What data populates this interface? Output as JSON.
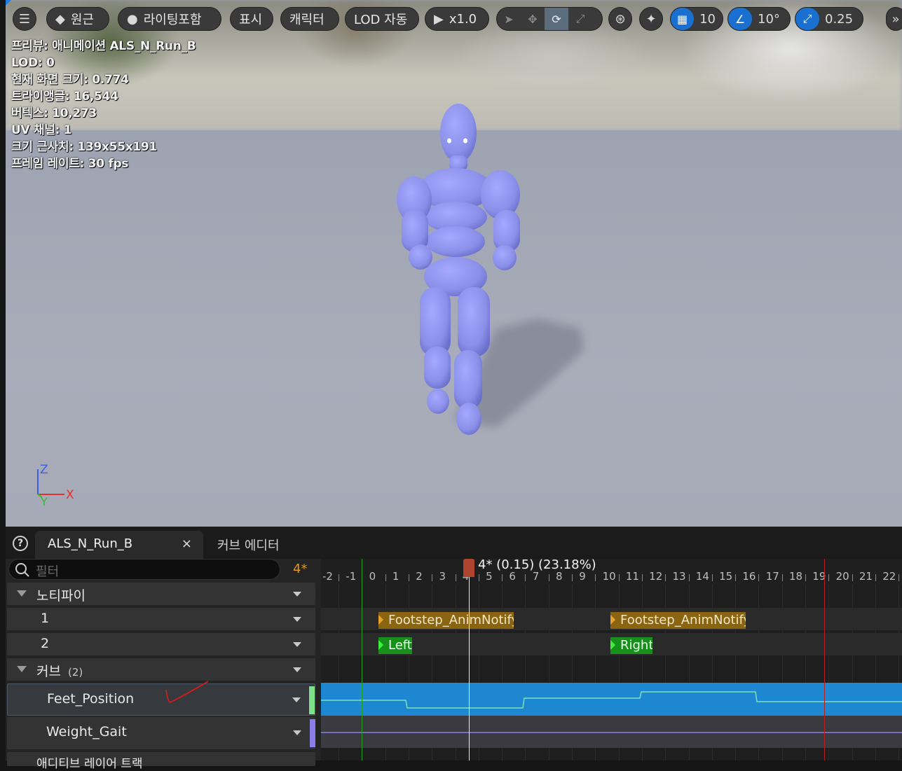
{
  "toolbar": {
    "menu_icon": "hamburger-icon",
    "perspective_label": "원근",
    "lighting_label": "라이팅포함",
    "show_label": "표시",
    "character_label": "캐릭터",
    "lod_label": "LOD 자동",
    "play_speed_label": "x1.0",
    "grid_snap_value": "10",
    "angle_snap_value": "10°",
    "scale_snap_value": "0.25"
  },
  "stats": {
    "line1": "프리뷰: 애니메이션 ALS_N_Run_B",
    "line2": "LOD: 0",
    "line3": "현재 화면 크기: 0.774",
    "line4": "트라이앵글: 16,544",
    "line5": "버텍스: 10,273",
    "line6": "UV 채널: 1",
    "line7": "크기 근사치: 139x55x191",
    "line8": "프레임 레이트: 30 fps"
  },
  "axis": {
    "z": "Z",
    "x": "X",
    "y": "Y"
  },
  "tabs": {
    "active": "ALS_N_Run_B",
    "second": "커브 에디터",
    "close": "×"
  },
  "tracks": {
    "filter_placeholder": "필터",
    "current_frame": "4*",
    "notify_header": "노티파이",
    "track1": "1",
    "track2": "2",
    "curves_header": "커브",
    "curves_count": "(2)",
    "curve1": "Feet_Position",
    "curve2": "Weight_Gait",
    "next_header": "애디티브 레이어 트랙"
  },
  "timeline": {
    "playhead_label": "4* (0.15) (23.18%)",
    "ticks": [
      "-2",
      "-1",
      "0",
      "1",
      "2",
      "3",
      "4",
      "5",
      "6",
      "7",
      "8",
      "9",
      "10",
      "11",
      "12",
      "13",
      "14",
      "15",
      "16",
      "17",
      "18",
      "19",
      "20",
      "21",
      "22"
    ],
    "notifies": {
      "footstep1": "Footstep_AnimNotify",
      "footstep2": "Footstep_AnimNotify",
      "left": "Left",
      "right": "Right"
    }
  },
  "colors": {
    "accent_blue": "#1a70d0",
    "notify_orange": "#8a6410",
    "notify_green": "#17901b",
    "curve_track": "#1d87d2",
    "mannequin": "#8a8fe8",
    "feet_swatch": "#7fe08a",
    "gait_swatch": "#8a7fe8"
  }
}
